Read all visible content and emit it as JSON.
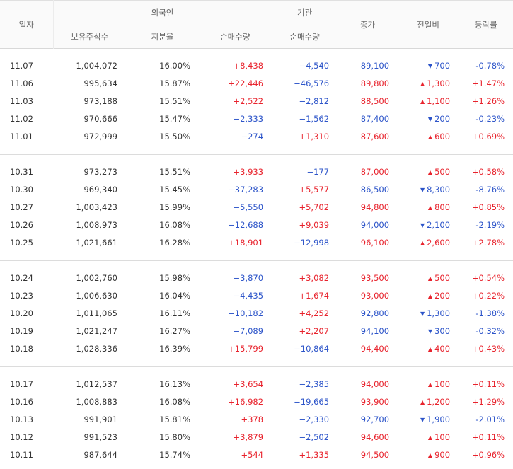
{
  "headers": {
    "date": "일자",
    "foreign": "외국인",
    "institution": "기관",
    "close": "종가",
    "change": "전일비",
    "rate": "등락률",
    "holdings": "보유주식수",
    "share": "지분율",
    "foreign_net": "순매수량",
    "inst_net": "순매수량"
  },
  "colors": {
    "up": "#e8232d",
    "down": "#2c54c9"
  },
  "groups": [
    {
      "rows": [
        {
          "date": "11.07",
          "holdings": "1,004,072",
          "share": "16.00%",
          "foreign_net": "+8,438",
          "inst_net": "−4,540",
          "close": "89,100",
          "dir": "down",
          "change": "700",
          "rate": "-0.78%"
        },
        {
          "date": "11.06",
          "holdings": "995,634",
          "share": "15.87%",
          "foreign_net": "+22,446",
          "inst_net": "−46,576",
          "close": "89,800",
          "dir": "up",
          "change": "1,300",
          "rate": "+1.47%"
        },
        {
          "date": "11.03",
          "holdings": "973,188",
          "share": "15.51%",
          "foreign_net": "+2,522",
          "inst_net": "−2,812",
          "close": "88,500",
          "dir": "up",
          "change": "1,100",
          "rate": "+1.26%"
        },
        {
          "date": "11.02",
          "holdings": "970,666",
          "share": "15.47%",
          "foreign_net": "−2,333",
          "inst_net": "−1,562",
          "close": "87,400",
          "dir": "down",
          "change": "200",
          "rate": "-0.23%"
        },
        {
          "date": "11.01",
          "holdings": "972,999",
          "share": "15.50%",
          "foreign_net": "−274",
          "inst_net": "+1,310",
          "close": "87,600",
          "dir": "up",
          "change": "600",
          "rate": "+0.69%"
        }
      ]
    },
    {
      "rows": [
        {
          "date": "10.31",
          "holdings": "973,273",
          "share": "15.51%",
          "foreign_net": "+3,933",
          "inst_net": "−177",
          "close": "87,000",
          "dir": "up",
          "change": "500",
          "rate": "+0.58%"
        },
        {
          "date": "10.30",
          "holdings": "969,340",
          "share": "15.45%",
          "foreign_net": "−37,283",
          "inst_net": "+5,577",
          "close": "86,500",
          "dir": "down",
          "change": "8,300",
          "rate": "-8.76%"
        },
        {
          "date": "10.27",
          "holdings": "1,003,423",
          "share": "15.99%",
          "foreign_net": "−5,550",
          "inst_net": "+5,702",
          "close": "94,800",
          "dir": "up",
          "change": "800",
          "rate": "+0.85%"
        },
        {
          "date": "10.26",
          "holdings": "1,008,973",
          "share": "16.08%",
          "foreign_net": "−12,688",
          "inst_net": "+9,039",
          "close": "94,000",
          "dir": "down",
          "change": "2,100",
          "rate": "-2.19%"
        },
        {
          "date": "10.25",
          "holdings": "1,021,661",
          "share": "16.28%",
          "foreign_net": "+18,901",
          "inst_net": "−12,998",
          "close": "96,100",
          "dir": "up",
          "change": "2,600",
          "rate": "+2.78%"
        }
      ]
    },
    {
      "rows": [
        {
          "date": "10.24",
          "holdings": "1,002,760",
          "share": "15.98%",
          "foreign_net": "−3,870",
          "inst_net": "+3,082",
          "close": "93,500",
          "dir": "up",
          "change": "500",
          "rate": "+0.54%"
        },
        {
          "date": "10.23",
          "holdings": "1,006,630",
          "share": "16.04%",
          "foreign_net": "−4,435",
          "inst_net": "+1,674",
          "close": "93,000",
          "dir": "up",
          "change": "200",
          "rate": "+0.22%"
        },
        {
          "date": "10.20",
          "holdings": "1,011,065",
          "share": "16.11%",
          "foreign_net": "−10,182",
          "inst_net": "+4,252",
          "close": "92,800",
          "dir": "down",
          "change": "1,300",
          "rate": "-1.38%"
        },
        {
          "date": "10.19",
          "holdings": "1,021,247",
          "share": "16.27%",
          "foreign_net": "−7,089",
          "inst_net": "+2,207",
          "close": "94,100",
          "dir": "down",
          "change": "300",
          "rate": "-0.32%"
        },
        {
          "date": "10.18",
          "holdings": "1,028,336",
          "share": "16.39%",
          "foreign_net": "+15,799",
          "inst_net": "−10,864",
          "close": "94,400",
          "dir": "up",
          "change": "400",
          "rate": "+0.43%"
        }
      ]
    },
    {
      "rows": [
        {
          "date": "10.17",
          "holdings": "1,012,537",
          "share": "16.13%",
          "foreign_net": "+3,654",
          "inst_net": "−2,385",
          "close": "94,000",
          "dir": "up",
          "change": "100",
          "rate": "+0.11%"
        },
        {
          "date": "10.16",
          "holdings": "1,008,883",
          "share": "16.08%",
          "foreign_net": "+16,982",
          "inst_net": "−19,665",
          "close": "93,900",
          "dir": "up",
          "change": "1,200",
          "rate": "+1.29%"
        },
        {
          "date": "10.13",
          "holdings": "991,901",
          "share": "15.81%",
          "foreign_net": "+378",
          "inst_net": "−2,330",
          "close": "92,700",
          "dir": "down",
          "change": "1,900",
          "rate": "-2.01%"
        },
        {
          "date": "10.12",
          "holdings": "991,523",
          "share": "15.80%",
          "foreign_net": "+3,879",
          "inst_net": "−2,502",
          "close": "94,600",
          "dir": "up",
          "change": "100",
          "rate": "+0.11%"
        },
        {
          "date": "10.11",
          "holdings": "987,644",
          "share": "15.74%",
          "foreign_net": "+544",
          "inst_net": "+1,335",
          "close": "94,500",
          "dir": "up",
          "change": "900",
          "rate": "+0.96%"
        }
      ]
    }
  ]
}
